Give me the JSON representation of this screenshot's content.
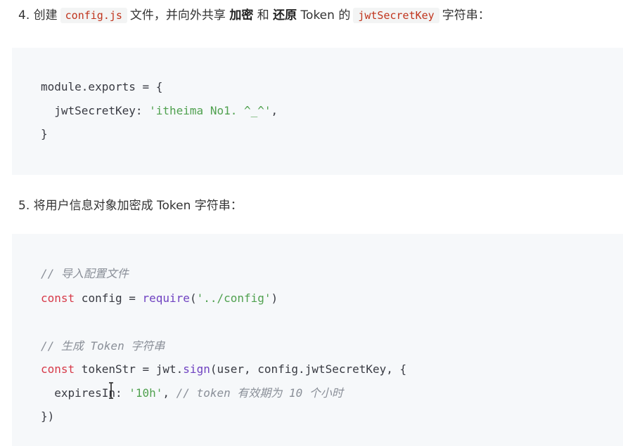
{
  "step4": {
    "num": "4.",
    "t1": "创建",
    "code1": "config.js",
    "t2": "文件，并向外共享",
    "b1": "加密",
    "t3": "和",
    "b2": "还原",
    "t4": "Token 的",
    "code2": "jwtSecretKey",
    "t5": "字符串："
  },
  "code_block_1": {
    "line1": "module.exports = {",
    "line2_key": "  jwtSecretKey: ",
    "line2_str": "'itheima No1. ^_^'",
    "line2_end": ",",
    "line3": "}"
  },
  "step5": {
    "text": "5. 将用户信息对象加密成 Token 字符串："
  },
  "code_block_2": {
    "comment1": "// 导入配置文件",
    "l2_kw": "const",
    "l2_mid": " config = ",
    "l2_fn": "require",
    "l2_open": "(",
    "l2_str": "'../config'",
    "l2_close": ")",
    "comment2": "// 生成 Token 字符串",
    "l4_kw": "const",
    "l4_mid": " tokenStr = jwt.",
    "l4_fn": "sign",
    "l4_rest": "(user, config.jwtSecretKey, {",
    "l5_key": "  expiresIn: ",
    "l5_str": "'10h'",
    "l5_comma": ", ",
    "l5_cm": "// token 有效期为 10 个小时",
    "l6": "})"
  }
}
